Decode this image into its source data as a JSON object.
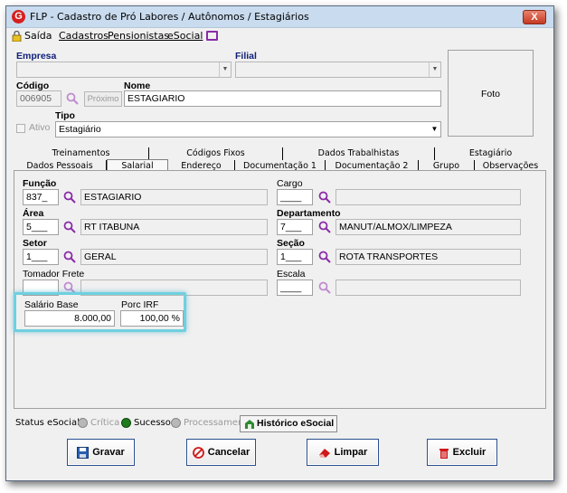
{
  "window": {
    "title": "FLP - Cadastro de Pró Labores / Autônomos / Estagiários",
    "close_glyph": "X",
    "app_icon_letter": "G"
  },
  "menu": {
    "items": [
      {
        "label": "Saída"
      },
      {
        "label": "Cadastros"
      },
      {
        "label": "Pensionistas"
      },
      {
        "label": "eSocial"
      }
    ]
  },
  "header": {
    "empresa_label": "Empresa",
    "empresa_value": "",
    "filial_label": "Filial",
    "filial_value": "",
    "codigo_label": "Código",
    "codigo_value": "006905",
    "proximo_label": "Próximo",
    "nome_label": "Nome",
    "nome_value": "ESTAGIARIO",
    "ativo_label": "Ativo",
    "tipo_label": "Tipo",
    "tipo_value": "Estagiário",
    "foto_label": "Foto"
  },
  "tabs_row1": [
    {
      "label": "Treinamentos"
    },
    {
      "label": "Códigos Fixos"
    },
    {
      "label": "Dados Trabalhistas"
    },
    {
      "label": "Estagiário"
    }
  ],
  "tabs_row2": [
    {
      "label": "Dados Pessoais"
    },
    {
      "label": "Salarial"
    },
    {
      "label": "Endereço"
    },
    {
      "label": "Documentação 1"
    },
    {
      "label": "Documentação 2"
    },
    {
      "label": "Grupo"
    },
    {
      "label": "Observações"
    }
  ],
  "salarial": {
    "funcao_label": "Função",
    "funcao_code": "837_",
    "funcao_desc": "ESTAGIARIO",
    "cargo_label": "Cargo",
    "cargo_code": "____",
    "cargo_desc": "",
    "area_label": "Área",
    "area_code": "5___",
    "area_desc": "RT ITABUNA",
    "departamento_label": "Departamento",
    "departamento_code": "7___",
    "departamento_desc": "MANUT/ALMOX/LIMPEZA",
    "setor_label": "Setor",
    "setor_code": "1___",
    "setor_desc": "GERAL",
    "secao_label": "Seção",
    "secao_code": "1___",
    "secao_desc": "ROTA TRANSPORTES",
    "tomador_label": "Tomador Frete",
    "tomador_code": "",
    "tomador_desc": "",
    "escala_label": "Escala",
    "escala_code": "____",
    "escala_desc": "",
    "salario_base_label": "Salário Base",
    "salario_base_value": "8.000,00",
    "porc_irf_label": "Porc IRF",
    "porc_irf_value": "100,00 %"
  },
  "status": {
    "label": "Status eSocial:",
    "critica": "Crítica",
    "sucesso": "Sucesso",
    "processamento": "Processamento",
    "historico_button": "Histórico eSocial"
  },
  "actions": {
    "gravar": "Gravar",
    "cancelar": "Cancelar",
    "limpar": "Limpar",
    "excluir": "Excluir"
  },
  "colors": {
    "highlight": "#6fd0e0",
    "search_icon": "#8a2aa8",
    "sucesso_dot": "#1e7a1e",
    "inactive_dot": "#a8a8a8"
  }
}
